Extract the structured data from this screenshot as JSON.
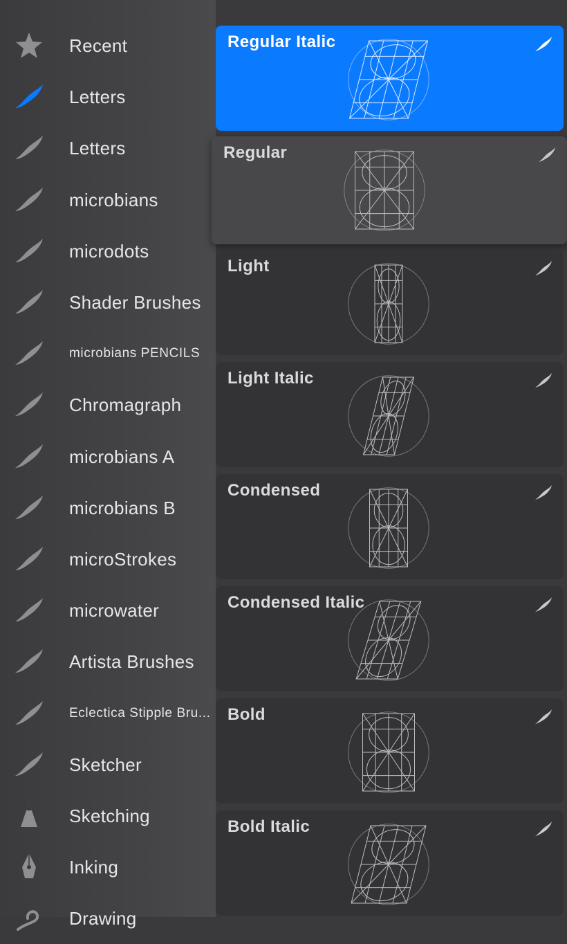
{
  "sidebar": {
    "items": [
      {
        "label": "Recent",
        "icon": "star-icon",
        "active": false
      },
      {
        "label": "Letters",
        "icon": "brush-stroke-icon",
        "active": true
      },
      {
        "label": "Letters",
        "icon": "brush-stroke-icon",
        "active": false
      },
      {
        "label": "microbians",
        "icon": "brush-stroke-icon",
        "active": false
      },
      {
        "label": "microdots",
        "icon": "brush-stroke-icon",
        "active": false
      },
      {
        "label": "Shader Brushes",
        "icon": "brush-stroke-icon",
        "active": false
      },
      {
        "label": "microbians PENCILS",
        "icon": "brush-stroke-icon",
        "active": false
      },
      {
        "label": "Chromagraph",
        "icon": "brush-stroke-icon",
        "active": false
      },
      {
        "label": "microbians A",
        "icon": "brush-stroke-icon",
        "active": false
      },
      {
        "label": "microbians B",
        "icon": "brush-stroke-icon",
        "active": false
      },
      {
        "label": "microStrokes",
        "icon": "brush-stroke-icon",
        "active": false
      },
      {
        "label": "microwater",
        "icon": "brush-stroke-icon",
        "active": false
      },
      {
        "label": "Artista Brushes",
        "icon": "brush-stroke-icon",
        "active": false
      },
      {
        "label": "Eclectica Stipple Bru...",
        "icon": "brush-stroke-icon",
        "active": false
      },
      {
        "label": "Sketcher",
        "icon": "brush-stroke-icon",
        "active": false
      },
      {
        "label": "Sketching",
        "icon": "pencil-tip-icon",
        "active": false
      },
      {
        "label": "Inking",
        "icon": "pen-nib-icon",
        "active": false
      },
      {
        "label": "Drawing",
        "icon": "drawing-loop-icon",
        "active": false
      }
    ]
  },
  "brushes": [
    {
      "name": "Regular Italic",
      "state": "selected",
      "slant": 0.25,
      "width": 0.85
    },
    {
      "name": "Regular",
      "state": "lifted",
      "slant": 0,
      "width": 0.85
    },
    {
      "name": "Light",
      "state": "normal",
      "slant": 0,
      "width": 0.4
    },
    {
      "name": "Light Italic",
      "state": "normal",
      "slant": 0.25,
      "width": 0.45
    },
    {
      "name": "Condensed",
      "state": "normal",
      "slant": 0,
      "width": 0.55
    },
    {
      "name": "Condensed Italic",
      "state": "normal",
      "slant": 0.3,
      "width": 0.6
    },
    {
      "name": "Bold",
      "state": "normal",
      "slant": 0,
      "width": 0.75
    },
    {
      "name": "Bold Italic",
      "state": "normal",
      "slant": 0.25,
      "width": 0.8
    }
  ],
  "colors": {
    "accent": "#0a7aff",
    "icon_gray": "#8e8e93",
    "text": "#e6e6e8",
    "card_bg": "#333335",
    "card_lifted_bg": "#48484a"
  }
}
